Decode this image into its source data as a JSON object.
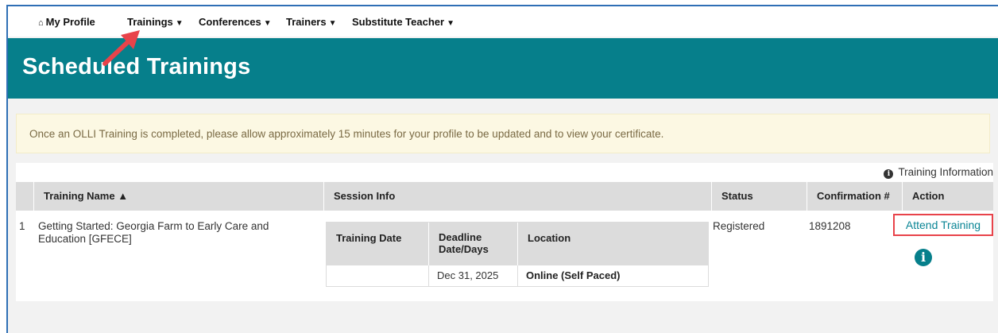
{
  "nav": {
    "home_label": "My Profile",
    "items": [
      {
        "label": "Trainings",
        "caret": "▼"
      },
      {
        "label": "Conferences",
        "caret": "▼"
      },
      {
        "label": "Trainers",
        "caret": "▼"
      },
      {
        "label": "Substitute Teacher",
        "caret": "▼"
      }
    ],
    "home_icon": "home-icon"
  },
  "header": {
    "title": "Scheduled Trainings",
    "band_color": "#067f8b"
  },
  "notice": {
    "text": "Once an OLLI Training is completed, please allow approximately 15 minutes for your profile to be updated and to view your certificate."
  },
  "info_link": {
    "label": "Training Information",
    "icon": "info-icon"
  },
  "table": {
    "headers": {
      "name": "Training Name ▲",
      "session": "Session Info",
      "status": "Status",
      "confirmation": "Confirmation #",
      "action": "Action"
    },
    "rows": [
      {
        "num": "1",
        "name": "Getting Started: Georgia Farm to Early Care and Education [GFECE]",
        "session": {
          "headers": {
            "date": "Training Date",
            "deadline": "Deadline Date/Days",
            "location": "Location"
          },
          "date": "",
          "deadline": "Dec 31, 2025",
          "location": "Online (Self Paced)"
        },
        "status": "Registered",
        "confirmation": "1891208",
        "action_label": "Attend Training",
        "action_icon": "info-icon"
      }
    ]
  },
  "colors": {
    "accent": "#067f8b",
    "highlight_border": "#e8434a",
    "annotation_arrow": "#e8434a",
    "notice_bg": "#fcf8e3"
  }
}
